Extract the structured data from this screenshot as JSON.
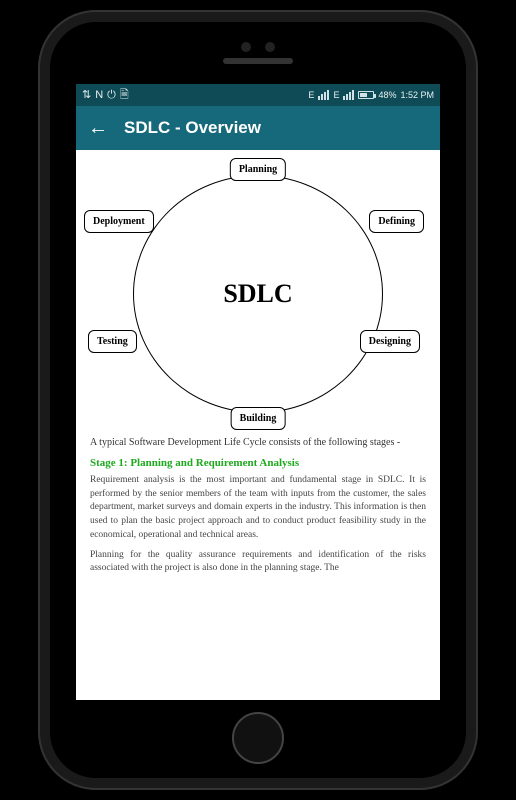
{
  "statusbar": {
    "network_label_1": "E",
    "network_label_2": "E",
    "battery_pct": "48%",
    "time": "1:52 PM"
  },
  "appbar": {
    "title": "SDLC - Overview"
  },
  "diagram": {
    "center": "SDLC",
    "nodes": {
      "planning": "Planning",
      "defining": "Defining",
      "designing": "Designing",
      "building": "Building",
      "testing": "Testing",
      "deployment": "Deployment"
    }
  },
  "article": {
    "intro": "A typical Software Development Life Cycle consists of the following stages -",
    "stage1_heading": "Stage 1: Planning and Requirement Analysis",
    "stage1_p1": "Requirement analysis is the most important and fundamental stage in SDLC. It is performed by the senior members of the team with inputs from the customer, the sales department, market surveys and domain experts in the industry. This information is then used to plan the basic project approach and to conduct product feasibility study in the economical, operational and technical areas.",
    "stage1_p2": "Planning for the quality assurance requirements and identification of the risks associated with the project is also done in the planning stage. The"
  }
}
